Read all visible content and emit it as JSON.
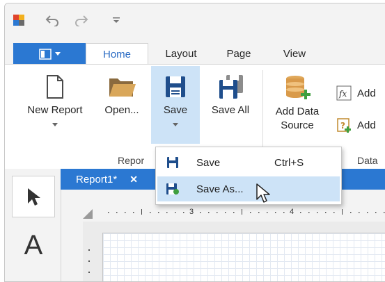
{
  "ribbon_tabs": [
    "Home",
    "Layout",
    "Page",
    "View"
  ],
  "ribbon_buttons": {
    "new_report": "New Report",
    "open": "Open...",
    "save": "Save",
    "save_all": "Save All",
    "add_data_source_line1": "Add Data",
    "add_data_source_line2": "Source",
    "add_1": "Add",
    "add_2": "Add"
  },
  "groups": {
    "report": "Repor",
    "data": "Data"
  },
  "document_tab": {
    "title": "Report1*",
    "close": "✕"
  },
  "save_menu": [
    {
      "label": "Save",
      "shortcut": "Ctrl+S",
      "icon": "floppy-icon"
    },
    {
      "label": "Save As...",
      "shortcut": "",
      "icon": "floppy-save-as-icon"
    }
  ],
  "ruler_labels": [
    "3",
    "4"
  ],
  "toolbox": {
    "label_tool": "A"
  },
  "colors": {
    "accent": "#2b78d2",
    "highlight": "#cde3f7",
    "save_icon": "#1f4e8c",
    "add_green": "#3f9f3f"
  }
}
